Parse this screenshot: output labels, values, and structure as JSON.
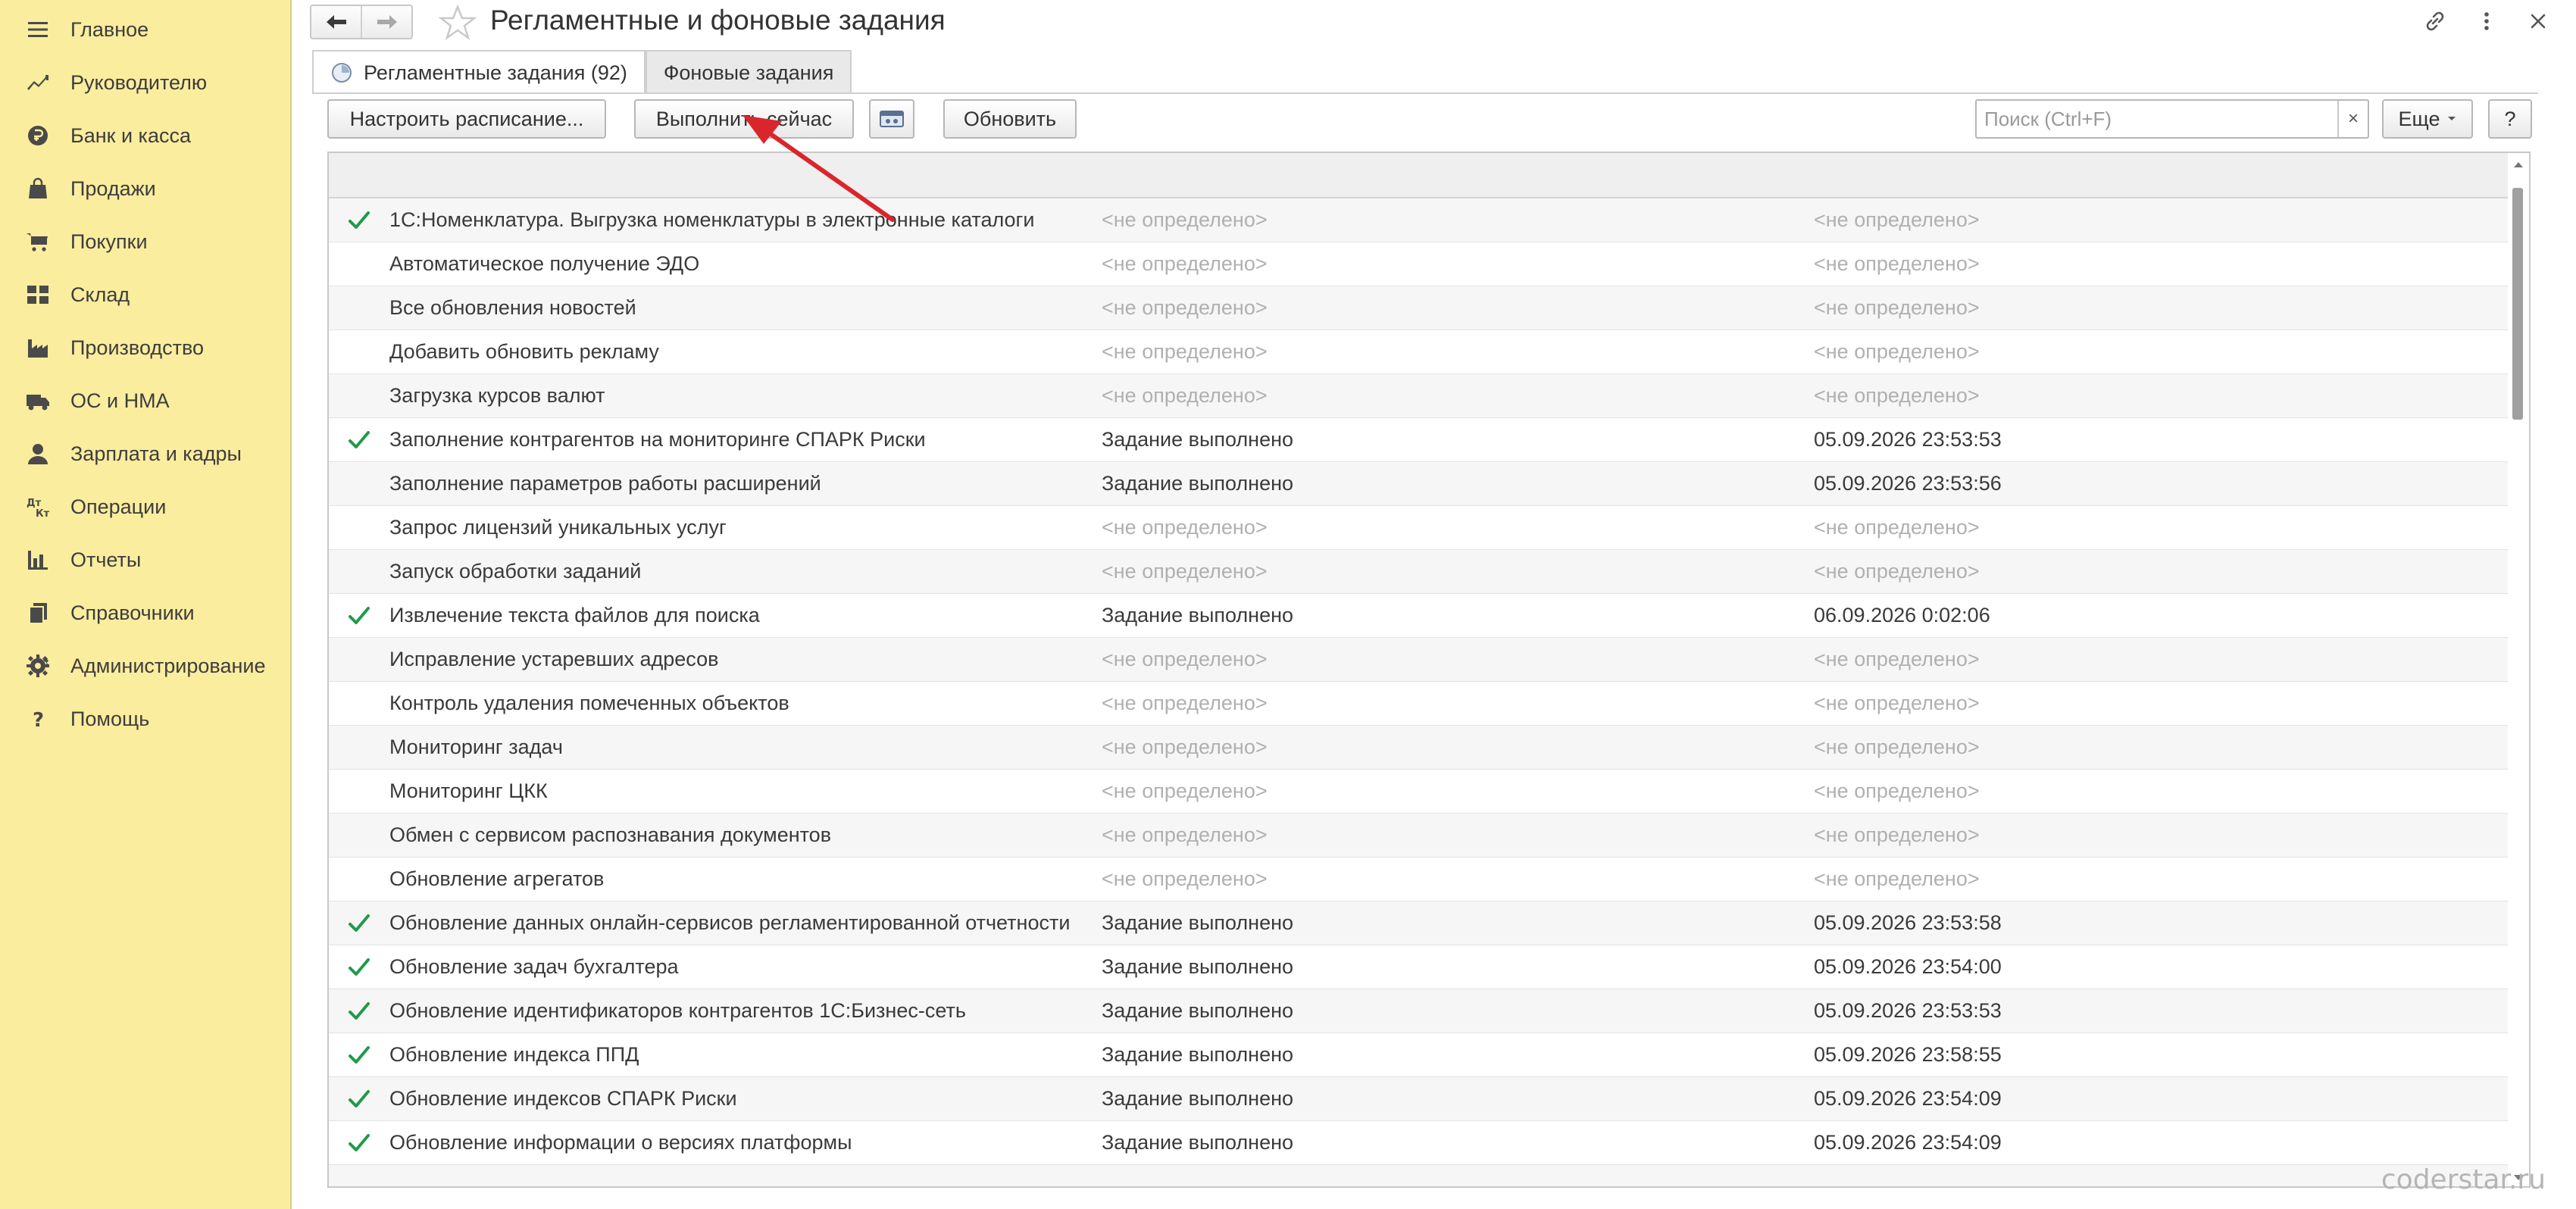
{
  "sidebar": {
    "items": [
      {
        "label": "Главное",
        "icon": "menu-icon"
      },
      {
        "label": "Руководителю",
        "icon": "trend-icon"
      },
      {
        "label": "Банк и касса",
        "icon": "ruble-coin-icon"
      },
      {
        "label": "Продажи",
        "icon": "bag-icon"
      },
      {
        "label": "Покупки",
        "icon": "cart-icon"
      },
      {
        "label": "Склад",
        "icon": "warehouse-icon"
      },
      {
        "label": "Производство",
        "icon": "factory-icon"
      },
      {
        "label": "ОС и НМА",
        "icon": "truck-icon"
      },
      {
        "label": "Зарплата и кадры",
        "icon": "person-icon"
      },
      {
        "label": "Операции",
        "icon": "debit-credit-icon"
      },
      {
        "label": "Отчеты",
        "icon": "bar-chart-icon"
      },
      {
        "label": "Справочники",
        "icon": "books-icon"
      },
      {
        "label": "Администрирование",
        "icon": "gear-icon"
      },
      {
        "label": "Помощь",
        "icon": "question-icon"
      }
    ]
  },
  "window": {
    "title": "Регламентные и фоновые задания"
  },
  "tabs": [
    {
      "label": "Регламентные задания (92)",
      "active": true
    },
    {
      "label": "Фоновые задания",
      "active": false
    }
  ],
  "toolbar": {
    "schedule_label": "Настроить расписание...",
    "run_now_label": "Выполнить сейчас",
    "refresh_label": "Обновить",
    "search_placeholder": "Поиск (Ctrl+F)",
    "clear_label": "×",
    "more_label": "Еще",
    "help_label": "?"
  },
  "table": {
    "rows": [
      {
        "done": true,
        "name": "1С:Номенклатура. Выгрузка номенклатуры в электронные каталоги",
        "state": "<не определено>",
        "date": "<не определено>"
      },
      {
        "done": false,
        "name": "Автоматическое получение ЭДО",
        "state": "<не определено>",
        "date": "<не определено>"
      },
      {
        "done": false,
        "name": "Все обновления новостей",
        "state": "<не определено>",
        "date": "<не определено>"
      },
      {
        "done": false,
        "name": "Добавить обновить рекламу",
        "state": "<не определено>",
        "date": "<не определено>"
      },
      {
        "done": false,
        "name": "Загрузка курсов валют",
        "state": "<не определено>",
        "date": "<не определено>"
      },
      {
        "done": true,
        "name": "Заполнение контрагентов на мониторинге СПАРК Риски",
        "state": "Задание выполнено",
        "date": "05.09.2026 23:53:53"
      },
      {
        "done": false,
        "name": "Заполнение параметров работы расширений",
        "state": "Задание выполнено",
        "date": "05.09.2026 23:53:56"
      },
      {
        "done": false,
        "name": "Запрос лицензий уникальных услуг",
        "state": "<не определено>",
        "date": "<не определено>"
      },
      {
        "done": false,
        "name": "Запуск обработки заданий",
        "state": "<не определено>",
        "date": "<не определено>"
      },
      {
        "done": true,
        "name": "Извлечение текста файлов для поиска",
        "state": "Задание выполнено",
        "date": "06.09.2026 0:02:06"
      },
      {
        "done": false,
        "name": "Исправление устаревших адресов",
        "state": "<не определено>",
        "date": "<не определено>"
      },
      {
        "done": false,
        "name": "Контроль удаления помеченных объектов",
        "state": "<не определено>",
        "date": "<не определено>"
      },
      {
        "done": false,
        "name": "Мониторинг задач",
        "state": "<не определено>",
        "date": "<не определено>"
      },
      {
        "done": false,
        "name": "Мониторинг ЦКК",
        "state": "<не определено>",
        "date": "<не определено>"
      },
      {
        "done": false,
        "name": "Обмен с сервисом распознавания документов",
        "state": "<не определено>",
        "date": "<не определено>"
      },
      {
        "done": false,
        "name": "Обновление агрегатов",
        "state": "<не определено>",
        "date": "<не определено>"
      },
      {
        "done": true,
        "name": "Обновление данных онлайн-сервисов регламентированной отчетности",
        "state": "Задание выполнено",
        "date": "05.09.2026 23:53:58"
      },
      {
        "done": true,
        "name": "Обновление задач бухгалтера",
        "state": "Задание выполнено",
        "date": "05.09.2026 23:54:00"
      },
      {
        "done": true,
        "name": "Обновление идентификаторов контрагентов 1С:Бизнес-сеть",
        "state": "Задание выполнено",
        "date": "05.09.2026 23:53:53"
      },
      {
        "done": true,
        "name": "Обновление индекса ППД",
        "state": "Задание выполнено",
        "date": "05.09.2026 23:58:55"
      },
      {
        "done": true,
        "name": "Обновление индексов СПАРК Риски",
        "state": "Задание выполнено",
        "date": "05.09.2026 23:54:09"
      },
      {
        "done": true,
        "name": "Обновление информации о версиях платформы",
        "state": "Задание выполнено",
        "date": "05.09.2026 23:54:09"
      },
      {
        "done": false,
        "name": "",
        "state": "",
        "date": ""
      }
    ]
  },
  "colors": {
    "sidebar_bg": "#fbed9e",
    "check": "#1f9a4a",
    "arrow": "#d9262b"
  },
  "watermark": "coderstar.ru"
}
